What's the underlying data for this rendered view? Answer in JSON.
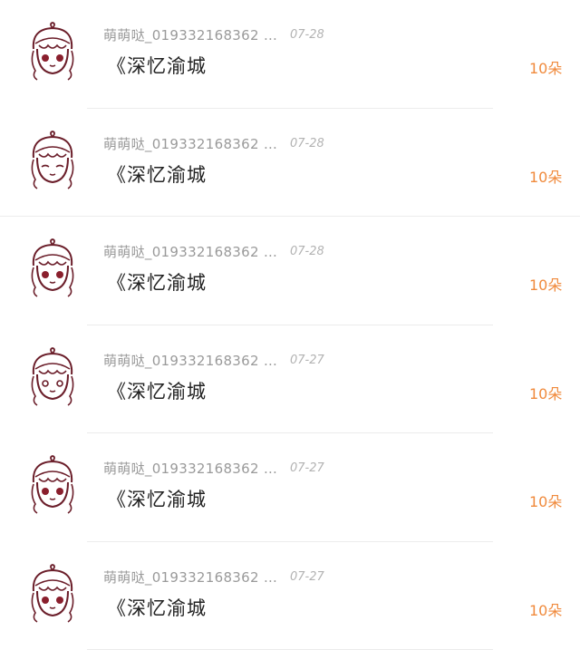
{
  "gifts": [
    {
      "name": "萌萌哒_019332168362 …",
      "date": "07-28",
      "message": "《深忆渝城",
      "amount": "10朵"
    },
    {
      "name": "萌萌哒_019332168362 …",
      "date": "07-28",
      "message": "《深忆渝城",
      "amount": "10朵"
    },
    {
      "name": "萌萌哒_019332168362 …",
      "date": "07-28",
      "message": "《深忆渝城",
      "amount": "10朵"
    },
    {
      "name": "萌萌哒_019332168362 …",
      "date": "07-27",
      "message": "《深忆渝城",
      "amount": "10朵"
    },
    {
      "name": "萌萌哒_019332168362 …",
      "date": "07-27",
      "message": "《深忆渝城",
      "amount": "10朵"
    },
    {
      "name": "萌萌哒_019332168362 …",
      "date": "07-27",
      "message": "《深忆渝城",
      "amount": "10朵"
    }
  ],
  "colors": {
    "amount": "#f08a3c",
    "name": "#9a9a9a",
    "avatar_line": "#6b1e2a",
    "avatar_cheek": "#8a1f2d"
  },
  "icons": {
    "avatar": "cartoon-girl-avatar-icon"
  }
}
